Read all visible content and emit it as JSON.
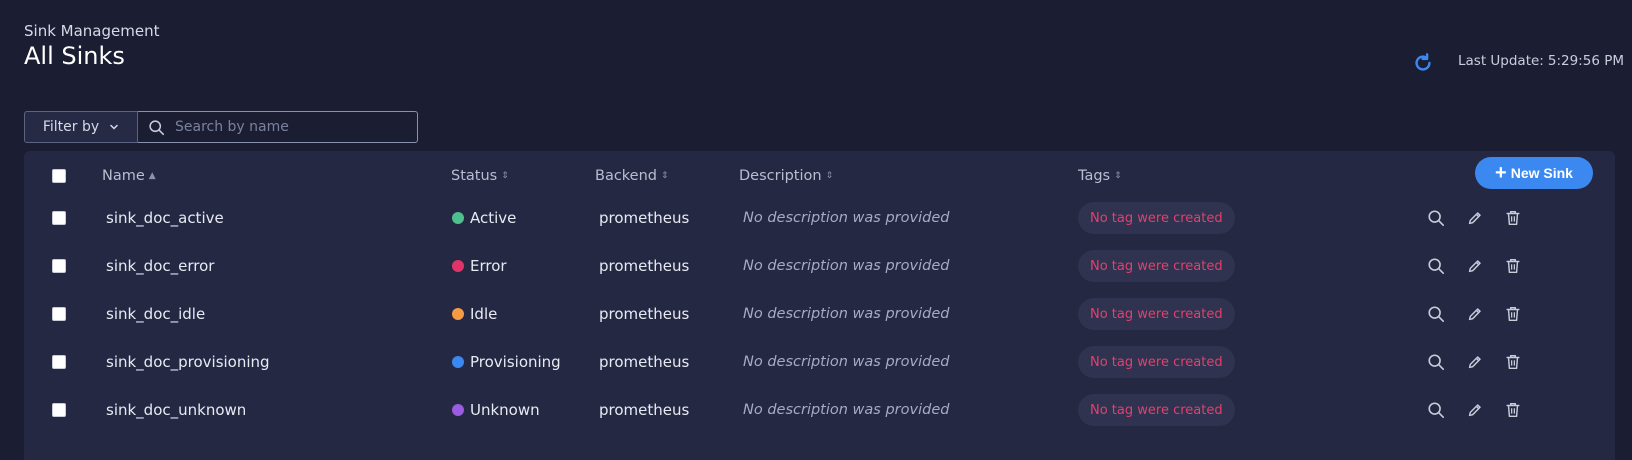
{
  "header": {
    "subtitle": "Sink Management",
    "title": "All Sinks",
    "last_update_label": "Last Update:",
    "last_update_time": "5:29:56 PM"
  },
  "filter": {
    "label": "Filter by",
    "search_placeholder": "Search by name"
  },
  "toolbar": {
    "new_sink_label": "New Sink"
  },
  "table": {
    "columns": [
      "Name",
      "Status",
      "Backend",
      "Description",
      "Tags"
    ],
    "rows": [
      {
        "name": "sink_doc_active",
        "status": "Active",
        "status_color": "#4fc08d",
        "backend": "prometheus",
        "description": "No description was provided",
        "tag": "No tag were created"
      },
      {
        "name": "sink_doc_error",
        "status": "Error",
        "status_color": "#e0336a",
        "backend": "prometheus",
        "description": "No description was provided",
        "tag": "No tag were created"
      },
      {
        "name": "sink_doc_idle",
        "status": "Idle",
        "status_color": "#f59a45",
        "backend": "prometheus",
        "description": "No description was provided",
        "tag": "No tag were created"
      },
      {
        "name": "sink_doc_provisioning",
        "status": "Provisioning",
        "status_color": "#3b89f0",
        "backend": "prometheus",
        "description": "No description was provided",
        "tag": "No tag were created"
      },
      {
        "name": "sink_doc_unknown",
        "status": "Unknown",
        "status_color": "#9a5ce0",
        "backend": "prometheus",
        "description": "No description was provided",
        "tag": "No tag were created"
      }
    ]
  },
  "icons": {
    "refresh": "refresh-icon",
    "chevron": "chevron-down-icon",
    "search": "search-icon",
    "view": "search-icon",
    "edit": "pencil-icon",
    "delete": "trash-icon"
  },
  "colors": {
    "accent": "#3b89f0",
    "background": "#1b1e33",
    "card": "#242843",
    "tag_text": "#e0416f"
  }
}
